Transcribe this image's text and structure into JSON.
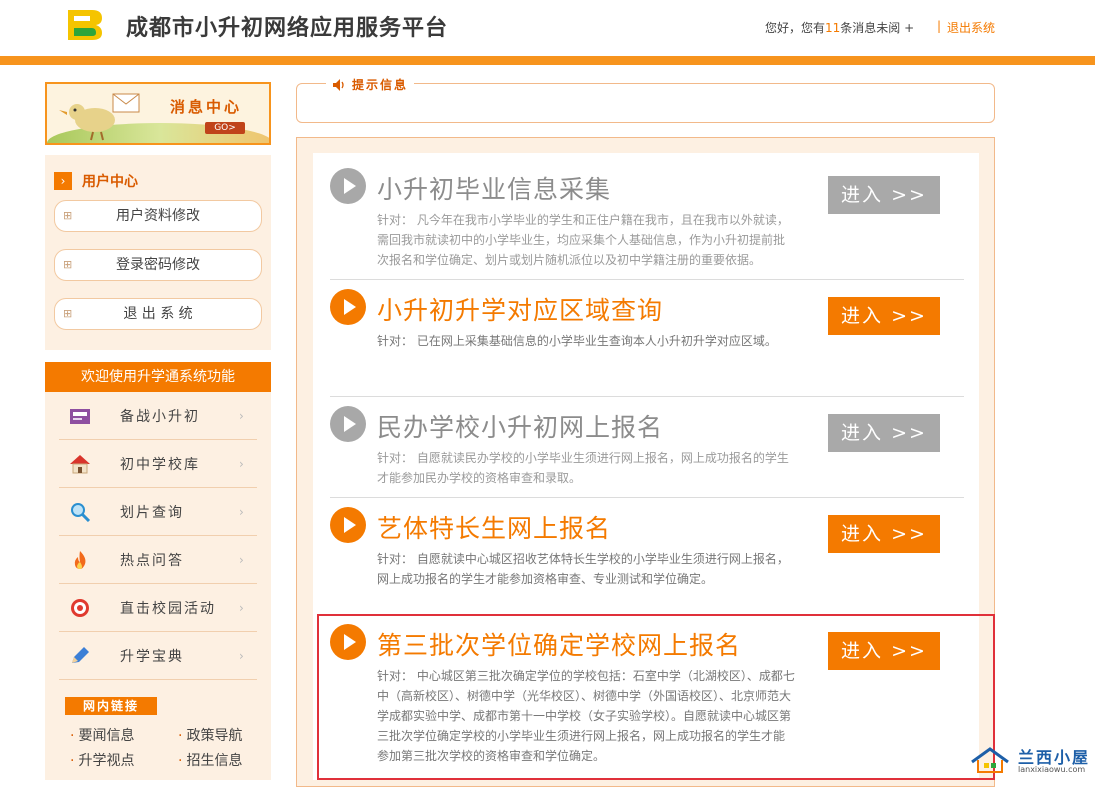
{
  "header": {
    "site_title": "成都市小升初网络应用服务平台",
    "greeting_prefix": "您好，您有",
    "message_count": "11",
    "greeting_suffix": "条消息未阅 +",
    "separator": "|",
    "logout": "退出系统"
  },
  "message_center": {
    "title": "消息中心",
    "go": "GO>"
  },
  "user_center": {
    "title": "用户中心",
    "buttons": [
      "用户资料修改",
      "登录密码修改",
      "退 出 系 统"
    ]
  },
  "welcome_bar": "欢迎使用升学通系统功能",
  "functions": [
    {
      "label": "备战小升初",
      "icon": "news-icon"
    },
    {
      "label": "初中学校库",
      "icon": "house-icon"
    },
    {
      "label": "划片查询",
      "icon": "magnifier-icon"
    },
    {
      "label": "热点问答",
      "icon": "flame-icon"
    },
    {
      "label": "直击校园活动",
      "icon": "target-icon"
    },
    {
      "label": "升学宝典",
      "icon": "pencil-icon"
    }
  ],
  "links": {
    "title": "网内链接",
    "items": [
      "要闻信息",
      "政策导航",
      "升学视点",
      "招生信息"
    ]
  },
  "notice": {
    "label": "提示信息"
  },
  "entries": [
    {
      "title": "小升初毕业信息采集",
      "desc": "针对：  凡今年在我市小学毕业的学生和正住户籍在我市，且在我市以外就读，需回我市就读初中的小学毕业生，均应采集个人基础信息，作为小升初提前批次报名和学位确定、划片或划片随机派位以及初中学籍注册的重要依据。",
      "button": "进入 >>",
      "state": "inactive"
    },
    {
      "title": "小升初升学对应区域查询",
      "desc": "针对：  已在网上采集基础信息的小学毕业生查询本人小升初升学对应区域。",
      "button": "进入 >>",
      "state": "active"
    },
    {
      "title": "民办学校小升初网上报名",
      "desc": "针对：  自愿就读民办学校的小学毕业生须进行网上报名，网上成功报名的学生才能参加民办学校的资格审查和录取。",
      "button": "进入 >>",
      "state": "inactive"
    },
    {
      "title": "艺体特长生网上报名",
      "desc": "针对：  自愿就读中心城区招收艺体特长生学校的小学毕业生须进行网上报名，网上成功报名的学生才能参加资格审查、专业测试和学位确定。",
      "button": "进入 >>",
      "state": "active"
    },
    {
      "title": "第三批次学位确定学校网上报名",
      "desc": "针对：  中心城区第三批次确定学位的学校包括：石室中学（北湖校区）、成都七中（高新校区）、树德中学（光华校区）、树德中学（外国语校区）、北京师范大学成都实验中学、成都市第十一中学校（女子实验学校）。自愿就读中心城区第三批次学位确定学校的小学毕业生须进行网上报名，网上成功报名的学生才能参加第三批次学校的资格审查和学位确定。",
      "button": "进入 >>",
      "state": "active"
    }
  ],
  "watermark": {
    "name": "兰西小屋",
    "domain": "lanxixiaowu.com"
  },
  "colors": {
    "accent": "#f47a00",
    "bar": "#f7941d",
    "highlight_border": "#e0303a",
    "inactive": "#a9a9a9"
  }
}
